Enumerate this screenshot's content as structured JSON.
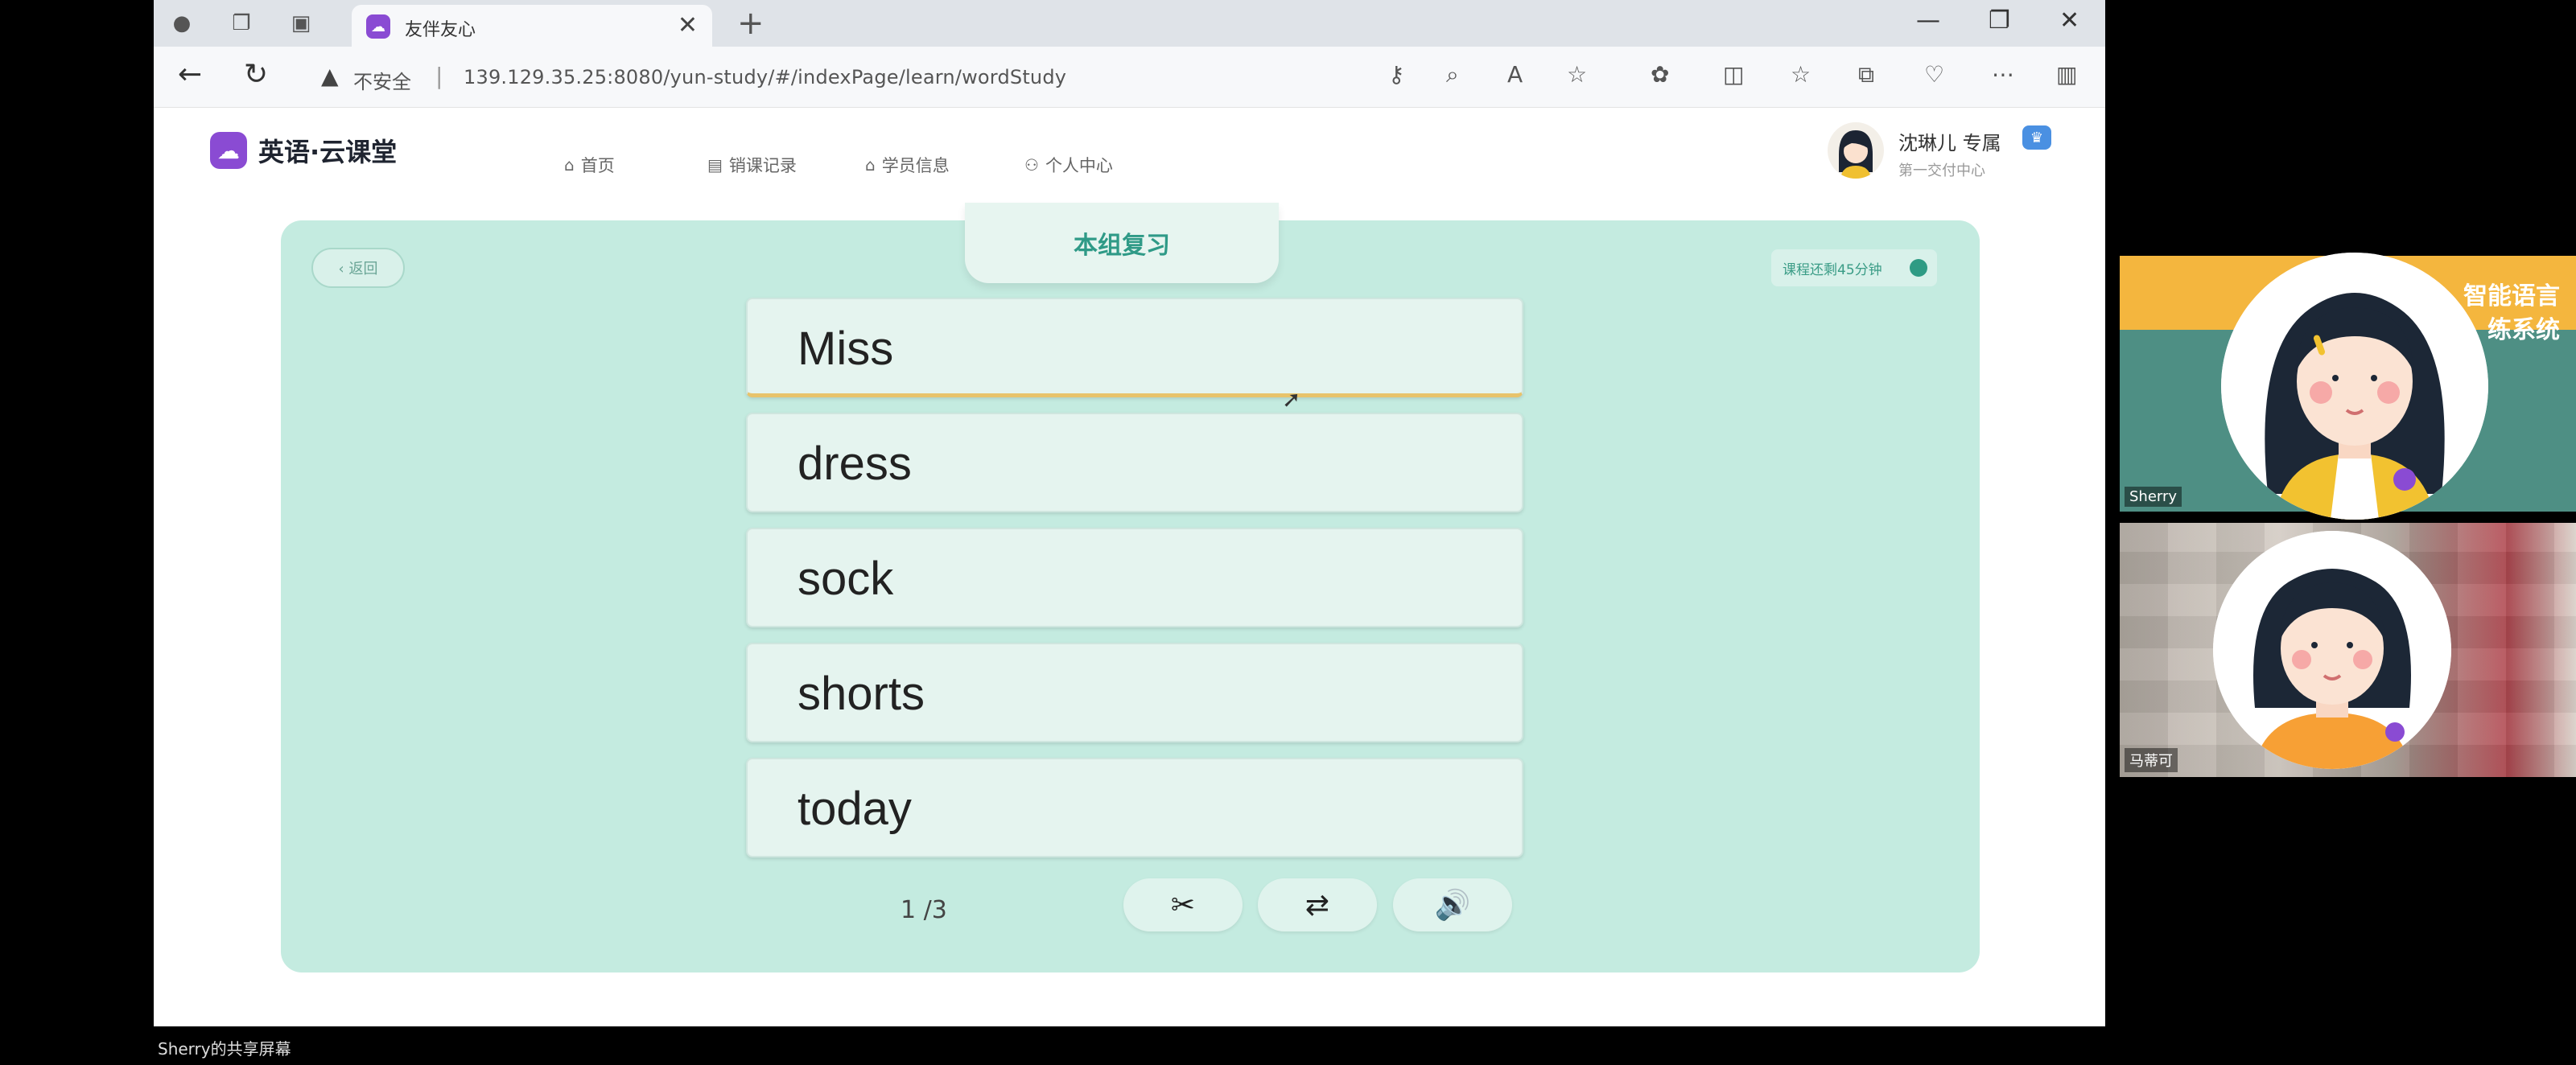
{
  "browser": {
    "tab_title": "友伴友心",
    "insecure_label": "不安全",
    "url_separator": "|",
    "url": "139.129.35.25:8080/yun-study/#/indexPage/learn/wordStudy"
  },
  "app": {
    "logo_text": "英语·云课堂",
    "nav": [
      {
        "icon": "⌂",
        "label": "首页"
      },
      {
        "icon": "▤",
        "label": "销课记录"
      },
      {
        "icon": "⌂",
        "label": "学员信息"
      },
      {
        "icon": "⚇",
        "label": "个人中心"
      }
    ],
    "profile": {
      "name": "沈琳儿 专属",
      "sub": "第一交付中心",
      "badge": "♛"
    }
  },
  "card": {
    "title": "本组复习",
    "back_label": "‹ 返回",
    "timer_text": "课程还剩45分钟"
  },
  "words": [
    "Miss",
    "dress",
    "sock",
    "shorts",
    "today"
  ],
  "controls": {
    "page_indicator": "1 /3",
    "buttons": [
      {
        "name": "scissors-button",
        "icon": "✂"
      },
      {
        "name": "shuffle-button",
        "icon": "⇄"
      },
      {
        "name": "speaker-button",
        "icon": "🔊"
      }
    ]
  },
  "share_label": "Sherry的共享屏幕",
  "video": {
    "tile1_banner_line1": "智能语言",
    "tile1_banner_line2": "练系统",
    "tile1_name": "Sherry",
    "tile2_name": "马蒂可"
  }
}
